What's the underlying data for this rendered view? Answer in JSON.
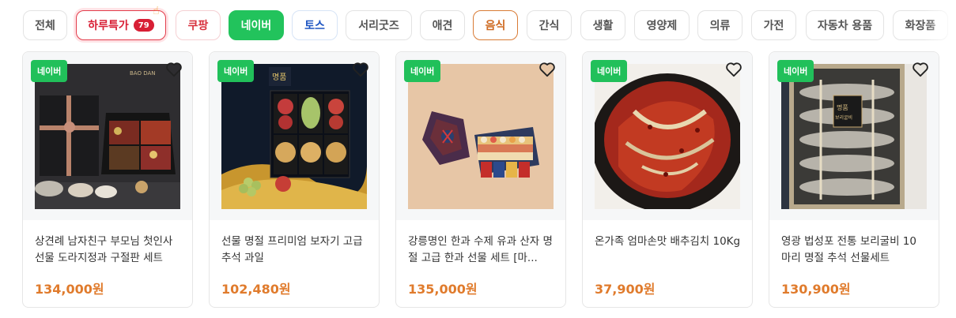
{
  "categories": [
    {
      "label": "전체"
    },
    {
      "label": "하루특가",
      "badge": "79"
    },
    {
      "label": "쿠팡"
    },
    {
      "label": "네이버"
    },
    {
      "label": "토스"
    },
    {
      "label": "서리굿즈"
    },
    {
      "label": "애견"
    },
    {
      "label": "음식"
    },
    {
      "label": "간식"
    },
    {
      "label": "생활"
    },
    {
      "label": "영양제"
    },
    {
      "label": "의류"
    },
    {
      "label": "가전"
    },
    {
      "label": "자동차 용품"
    },
    {
      "label": "화장품"
    }
  ],
  "products": [
    {
      "tag": "네이버",
      "title": "상견례 남자친구 부모님 첫인사 선물 도라지정과 구절판 세트",
      "price": "134,000원",
      "image": "doraji-gift-box"
    },
    {
      "tag": "네이버",
      "title": "선물 명절 프리미엄 보자기 고급 추석 과일",
      "price": "102,480원",
      "image": "fruit-gift-box"
    },
    {
      "tag": "네이버",
      "title": "강릉명인 한과 수제 유과 산자 명절 고급 한과 선물 세트 [마...",
      "price": "135,000원",
      "image": "hangwa-gift-set"
    },
    {
      "tag": "네이버",
      "title": "온가족 엄마손맛 배추김치 10Kg",
      "price": "37,900원",
      "image": "kimchi-plate"
    },
    {
      "tag": "네이버",
      "title": "영광 법성포 전통 보리굴비 10 마리 명절 추석 선물세트",
      "price": "130,900원",
      "image": "gulbi-gift-box"
    }
  ],
  "colors": {
    "naver_green": "#21c05a",
    "price_orange": "#e07b2c",
    "sale_red": "#d81f35",
    "food_orange": "#cf6a22",
    "toss_blue": "#1f56c2"
  }
}
